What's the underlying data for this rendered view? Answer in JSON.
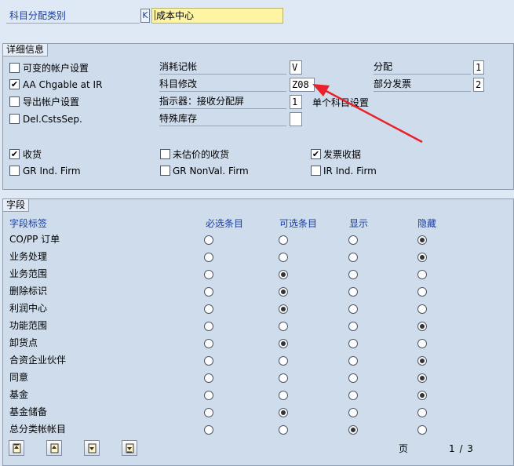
{
  "top": {
    "label": "科目分配类别",
    "key": "K",
    "value": "成本中心"
  },
  "details": {
    "title": "详细信息",
    "checkboxes_left": [
      {
        "label": "可变的帐户设置",
        "checked": false
      },
      {
        "label": "AA Chgable at IR",
        "checked": true
      },
      {
        "label": "导出帐户设置",
        "checked": false
      },
      {
        "label": "Del.CstsSep.",
        "checked": false
      }
    ],
    "fields_mid": [
      {
        "label": "消耗记帐",
        "value": "V"
      },
      {
        "label": "科目修改",
        "value": "Z08"
      },
      {
        "label": "指示器：接收分配屏",
        "value": "1"
      },
      {
        "label": "特殊库存",
        "value": ""
      }
    ],
    "fields_right": [
      {
        "label": "分配",
        "value": "1"
      },
      {
        "label": "部分发票",
        "value": "2"
      }
    ],
    "single_label": "单个科目设置",
    "gr_checks": [
      {
        "label": "收货",
        "checked": true
      },
      {
        "label": "未估价的收货",
        "checked": false
      },
      {
        "label": "发票收据",
        "checked": true
      },
      {
        "label": "GR Ind. Firm",
        "checked": false
      },
      {
        "label": "GR NonVal. Firm",
        "checked": false
      },
      {
        "label": "IR Ind. Firm",
        "checked": false
      }
    ]
  },
  "fields": {
    "title": "字段",
    "headers": [
      "字段标签",
      "必选条目",
      "可选条目",
      "显示",
      "隐藏"
    ],
    "rows": [
      {
        "label": "CO/PP 订单",
        "sel": 3
      },
      {
        "label": "业务处理",
        "sel": 3
      },
      {
        "label": "业务范围",
        "sel": 1
      },
      {
        "label": "删除标识",
        "sel": 1
      },
      {
        "label": "利润中心",
        "sel": 1
      },
      {
        "label": "功能范围",
        "sel": 3
      },
      {
        "label": "卸货点",
        "sel": 1
      },
      {
        "label": "合资企业伙伴",
        "sel": 3
      },
      {
        "label": "同意",
        "sel": 3
      },
      {
        "label": "基金",
        "sel": 3
      },
      {
        "label": "基金储备",
        "sel": 1
      },
      {
        "label": "总分类帐帐目",
        "sel": 2
      }
    ]
  },
  "pager": {
    "page_label": "页",
    "page_value": "1 / 3"
  },
  "colors": {
    "accent_red": "#e8222a",
    "label_blue": "#1a3fa0"
  }
}
